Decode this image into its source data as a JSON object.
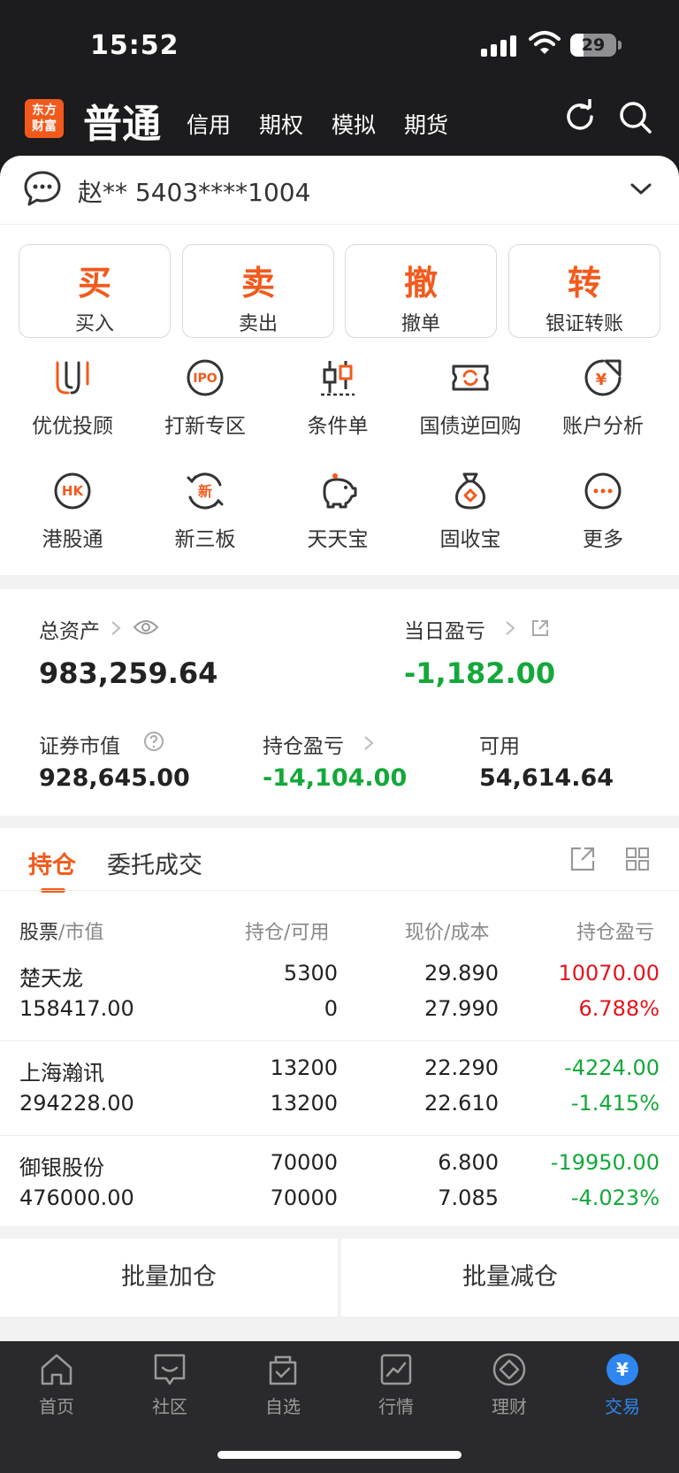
{
  "status": {
    "time": "15:52",
    "battery": "29",
    "battery_level": 0.29
  },
  "nav": {
    "logo_top": "东方",
    "logo_bottom": "财富",
    "active": "普通",
    "tabs": [
      "信用",
      "期权",
      "模拟",
      "期货"
    ]
  },
  "account": {
    "text": "赵** 5403****1004"
  },
  "trade_buttons": [
    {
      "glyph": "买",
      "label": "买入"
    },
    {
      "glyph": "卖",
      "label": "卖出"
    },
    {
      "glyph": "撤",
      "label": "撤单"
    },
    {
      "glyph": "转",
      "label": "银证转账"
    }
  ],
  "grid": [
    {
      "label": "优优投顾",
      "icon": "uu-advisor-icon"
    },
    {
      "label": "打新专区",
      "icon": "ipo-icon",
      "icon_text": "IPO"
    },
    {
      "label": "条件单",
      "icon": "candlestick-icon"
    },
    {
      "label": "国债逆回购",
      "icon": "ticket-refresh-icon"
    },
    {
      "label": "账户分析",
      "icon": "yuan-chart-icon",
      "icon_text": "¥"
    },
    {
      "label": "港股通",
      "icon": "hk-icon",
      "icon_text": "HK"
    },
    {
      "label": "新三板",
      "icon": "new-board-icon",
      "icon_text": "新"
    },
    {
      "label": "天天宝",
      "icon": "piggy-bank-icon"
    },
    {
      "label": "固收宝",
      "icon": "money-bag-icon"
    },
    {
      "label": "更多",
      "icon": "more-icon"
    }
  ],
  "assets": {
    "total_label": "总资产",
    "total_value": "983,259.64",
    "daily_label": "当日盈亏",
    "daily_value": "-1,182.00",
    "market_label": "证券市值",
    "market_value": "928,645.00",
    "position_pl_label": "持仓盈亏",
    "position_pl_value": "-14,104.00",
    "available_label": "可用",
    "available_value": "54,614.64"
  },
  "holdings": {
    "tabs": [
      "持仓",
      "委托成交"
    ],
    "headers": {
      "stock": "股票",
      "mv": "市值",
      "pos": "持仓",
      "avail": "可用",
      "price": "现价",
      "cost": "成本",
      "pl": "持仓盈亏",
      "sep": "/"
    },
    "rows": [
      {
        "name": "楚天龙",
        "market_value": "158417.00",
        "position": "5300",
        "available": "0",
        "price": "29.890",
        "cost": "27.990",
        "pl": "10070.00",
        "pl_pct": "6.788%",
        "trend": "up"
      },
      {
        "name": "上海瀚讯",
        "market_value": "294228.00",
        "position": "13200",
        "available": "13200",
        "price": "22.290",
        "cost": "22.610",
        "pl": "-4224.00",
        "pl_pct": "-1.415%",
        "trend": "down"
      },
      {
        "name": "御银股份",
        "market_value": "476000.00",
        "position": "70000",
        "available": "70000",
        "price": "6.800",
        "cost": "7.085",
        "pl": "-19950.00",
        "pl_pct": "-4.023%",
        "trend": "down"
      }
    ]
  },
  "batch": {
    "add": "批量加仓",
    "reduce": "批量减仓"
  },
  "tabbar": [
    {
      "label": "首页",
      "icon": "home-icon"
    },
    {
      "label": "社区",
      "icon": "community-icon"
    },
    {
      "label": "自选",
      "icon": "watchlist-icon"
    },
    {
      "label": "行情",
      "icon": "market-chart-icon"
    },
    {
      "label": "理财",
      "icon": "wealth-icon"
    },
    {
      "label": "交易",
      "icon": "trade-yuan-icon",
      "icon_text": "¥",
      "active": true
    }
  ],
  "colors": {
    "accent": "#f25a1d",
    "up": "#e3141e",
    "down": "#14a83a",
    "tab_active": "#2e86f0"
  }
}
